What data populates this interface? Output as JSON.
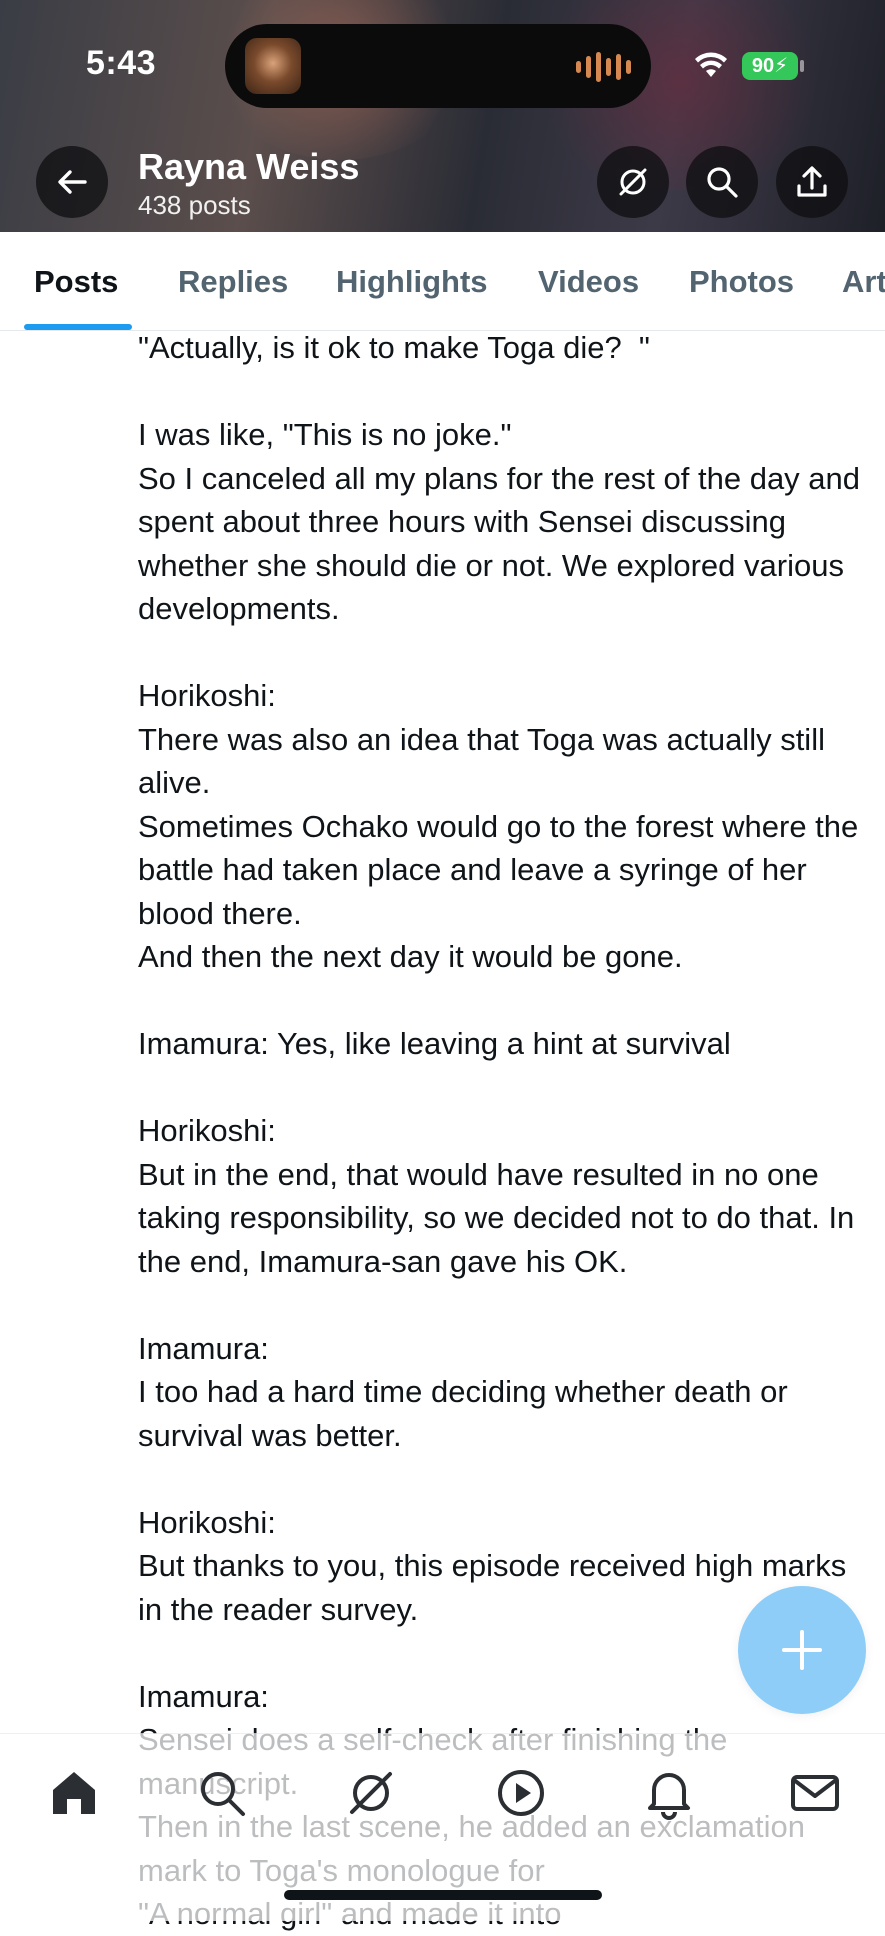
{
  "status_bar": {
    "time": "5:43",
    "battery": "90"
  },
  "header": {
    "name": "Rayna Weiss",
    "post_count": "438 posts"
  },
  "tabs": [
    {
      "label": "Posts"
    },
    {
      "label": "Replies"
    },
    {
      "label": "Highlights"
    },
    {
      "label": "Videos"
    },
    {
      "label": "Photos"
    },
    {
      "label": "Art"
    }
  ],
  "post": {
    "paragraphs": [
      "\"Actually, is it ok to make Toga die?  \"",
      "",
      "I was like, \"This is no joke.\"",
      "So I canceled all my plans for the rest of the day and spent about three hours with Sensei discussing whether she should die or not. We explored various developments.",
      "",
      "Horikoshi:",
      "There was also an idea that Toga was actually still alive.",
      "Sometimes Ochako would go to the forest where the battle had taken place and leave a syringe of her blood there.",
      "And then the next day it would be gone.",
      "",
      "Imamura: Yes, like leaving a hint at survival",
      "",
      "Horikoshi:",
      "But in the end, that would have resulted in no one taking responsibility, so we decided not to do that. In the end, Imamura-san gave his OK.",
      "",
      "Imamura:",
      "I too had a hard time deciding whether death or survival was better.",
      "",
      "Horikoshi:",
      "But thanks to you, this episode received high marks in the reader survey.",
      "",
      "Imamura:",
      "Sensei does a self-check after finishing the manuscript.",
      "Then in the last scene, he added an exclamation mark to Toga's monologue for",
      "\"A normal girl\" and made it into"
    ]
  },
  "icons": {
    "back": "back-arrow-icon",
    "grok": "grok-icon",
    "search": "search-icon",
    "share": "share-icon",
    "compose": "plus-icon",
    "nav": [
      "home-icon",
      "search-icon",
      "grok-icon",
      "video-play-icon",
      "bell-icon",
      "mail-icon"
    ]
  },
  "colors": {
    "accent": "#1d9bf0",
    "fab": "#8ecdf8",
    "battery": "#34c759"
  }
}
